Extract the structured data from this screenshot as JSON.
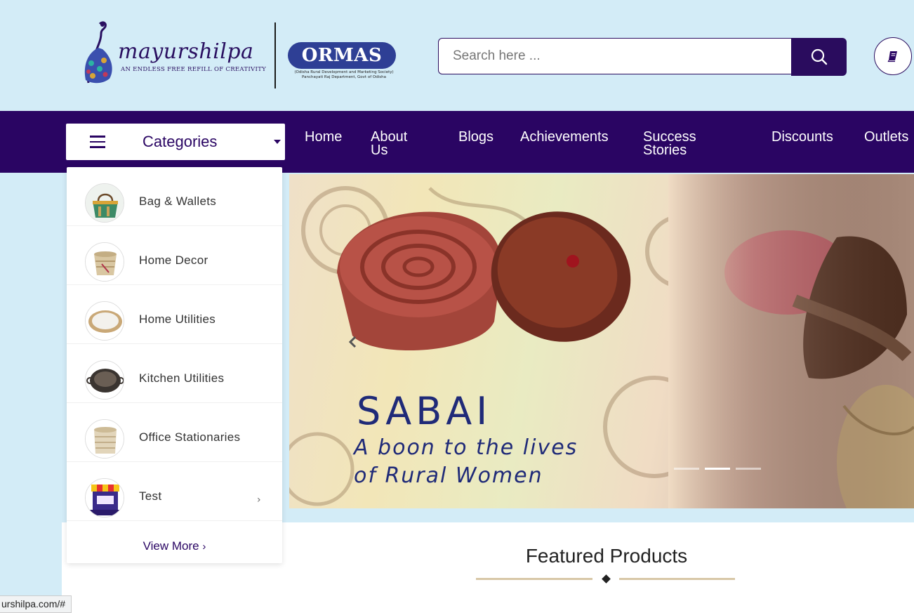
{
  "header": {
    "brand_name": "mayurshilpa",
    "tagline": "An Endless Free Refill of Creativity",
    "partner_name": "ORMAS",
    "partner_subtitle_1": "(Odisha Rural Development and Marketing Society)",
    "partner_subtitle_2": "Panchayati Raj Department, Govt of Odisha",
    "search_placeholder": "Search here ...",
    "search_icon": "search-icon",
    "book_icon": "book-icon"
  },
  "nav": {
    "categories_label": "Categories",
    "items": [
      {
        "label": "Home"
      },
      {
        "label": "About Us"
      },
      {
        "label": "Blogs"
      },
      {
        "label": "Achievements"
      },
      {
        "label": "Success Stories"
      },
      {
        "label": "Discounts"
      },
      {
        "label": "Outlets"
      }
    ]
  },
  "categories": {
    "items": [
      {
        "label": "Bag & Wallets"
      },
      {
        "label": "Home Decor"
      },
      {
        "label": "Home Utilities"
      },
      {
        "label": "Kitchen Utilities"
      },
      {
        "label": "Office Stationaries"
      },
      {
        "label": "Test"
      }
    ],
    "view_more": "View More"
  },
  "hero": {
    "title": "SABAI",
    "subtitle_line1": "A boon to the lives",
    "subtitle_line2": "of Rural Women",
    "slide_count": 3,
    "active_slide": 2
  },
  "featured": {
    "title": "Featured Products"
  },
  "status_bar": {
    "url": "urshilpa.com/#"
  },
  "colors": {
    "primary": "#2a0563",
    "header_bg": "#d3ecf7",
    "hero_text": "#1f2a78",
    "partner_blue": "#2e3f95",
    "accent_line": "#d8c7a7"
  }
}
